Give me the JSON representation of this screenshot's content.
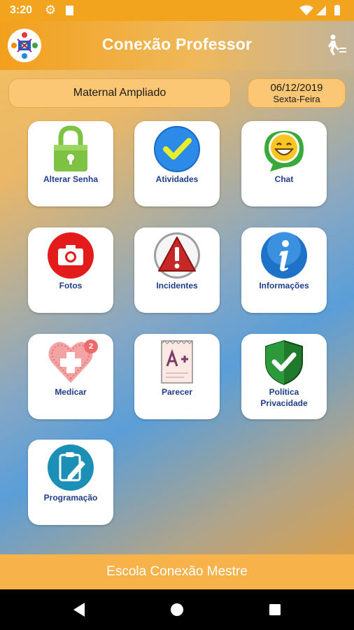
{
  "status_bar": {
    "time": "3:20",
    "icons": [
      "gear-icon",
      "sd-card-icon",
      "wifi-icon",
      "signal-icon",
      "battery-icon"
    ]
  },
  "app_bar": {
    "title": "Conexão Professor",
    "logo": "school-logo",
    "exit_icon": "exit-person-icon"
  },
  "class_selector": {
    "value": "Maternal Ampliado"
  },
  "date_box": {
    "date": "06/12/2019",
    "weekday": "Sexta-Feira"
  },
  "tiles": [
    {
      "label": "Alterar Senha",
      "icon": "lock-icon"
    },
    {
      "label": "Atividades",
      "icon": "checkmark-circle-icon"
    },
    {
      "label": "Chat",
      "icon": "chat-smiley-icon"
    },
    {
      "label": "Fotos",
      "icon": "camera-icon"
    },
    {
      "label": "Incidentes",
      "icon": "warning-icon"
    },
    {
      "label": "Informações",
      "icon": "info-icon"
    },
    {
      "label": "Medicar",
      "icon": "medical-heart-icon",
      "badge": "2"
    },
    {
      "label": "Parecer",
      "icon": "grade-paper-icon"
    },
    {
      "label_line1": "Política",
      "label_line2": "Privacidade",
      "icon": "shield-check-icon"
    },
    {
      "label": "Programação",
      "icon": "clipboard-edit-icon"
    }
  ],
  "footer": {
    "text": "Escola Conexão Mestre"
  },
  "nav_bar": {
    "buttons": [
      "back-icon",
      "home-icon",
      "recents-icon"
    ]
  },
  "colors": {
    "accent_orange": "#f3a41e",
    "pill": "#fcc774",
    "label_blue": "#1f3d8a",
    "badge_red": "#ef6b6b"
  }
}
